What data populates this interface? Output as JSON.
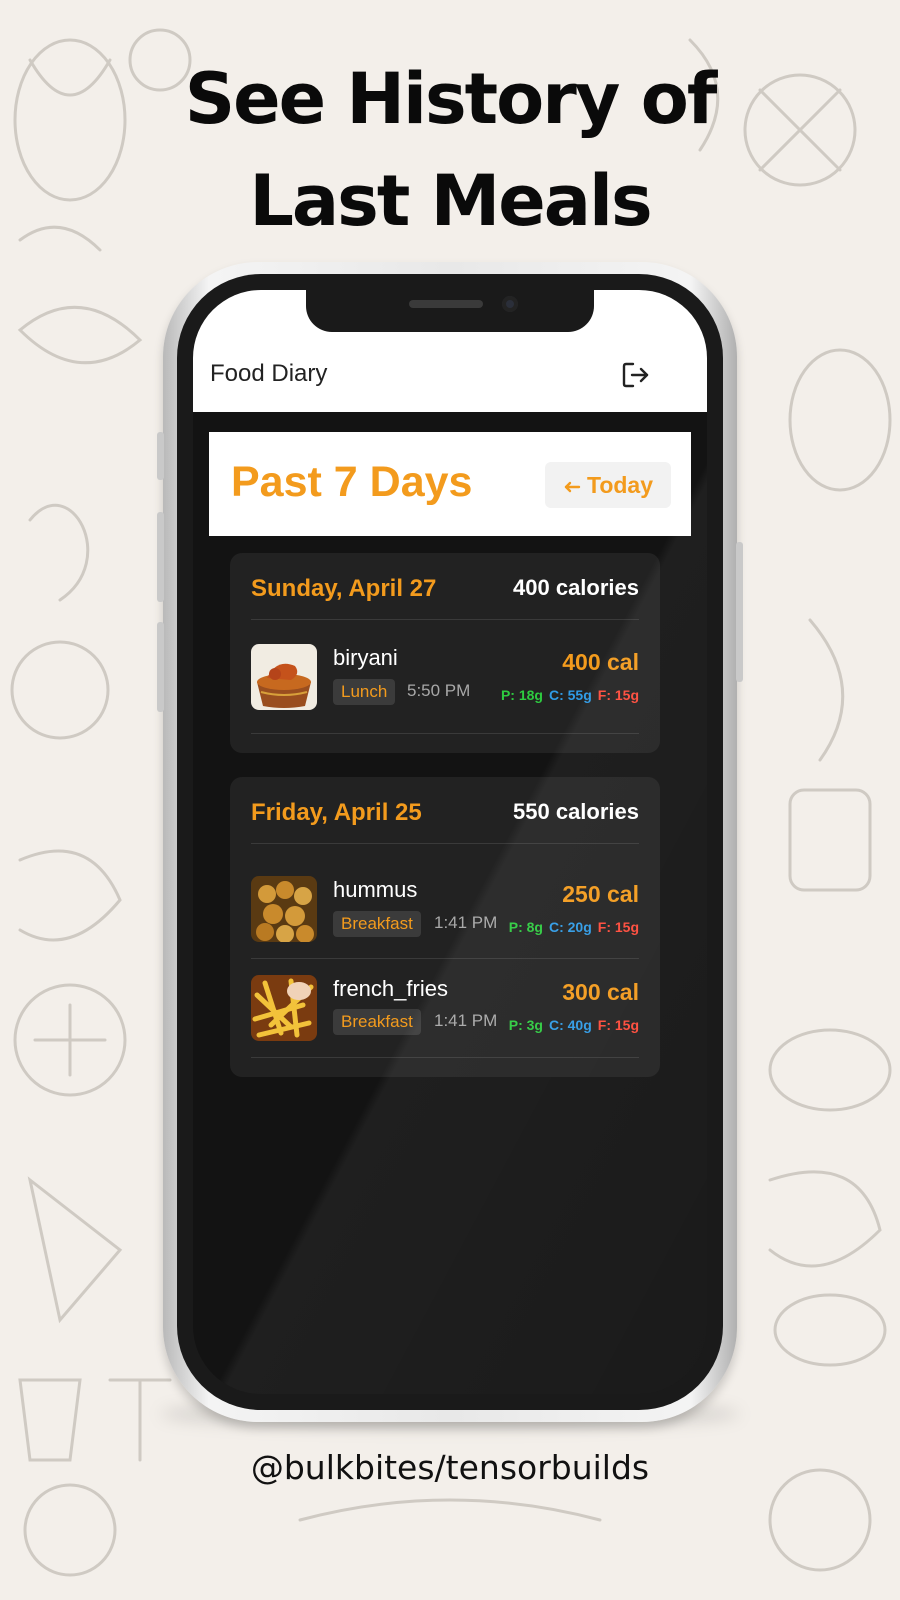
{
  "poster": {
    "headline_line1": "See History of",
    "headline_line2": "Last Meals",
    "credit": "@bulkbites/tensorbuilds"
  },
  "app": {
    "title": "Food Diary",
    "logout_icon": "logout-icon",
    "range_title": "Past 7 Days",
    "today_button": "Today",
    "today_icon": "arrow-left-icon"
  },
  "days": [
    {
      "date": "Sunday, April 27",
      "total": "400 calories",
      "meals": [
        {
          "name": "biryani",
          "tag": "Lunch",
          "time": "5:50 PM",
          "calories": "400 cal",
          "protein": "P: 18g",
          "carbs": "C: 55g",
          "fat": "F: 15g"
        }
      ]
    },
    {
      "date": "Friday, April 25",
      "total": "550 calories",
      "meals": [
        {
          "name": "hummus",
          "tag": "Breakfast",
          "time": "1:41 PM",
          "calories": "250 cal",
          "protein": "P: 8g",
          "carbs": "C: 20g",
          "fat": "F: 15g"
        },
        {
          "name": "french_fries",
          "tag": "Breakfast",
          "time": "1:41 PM",
          "calories": "300 cal",
          "protein": "P: 3g",
          "carbs": "C: 40g",
          "fat": "F: 15g"
        }
      ]
    }
  ],
  "colors": {
    "accent": "#f39b1d",
    "protein": "#2ecc40",
    "carbs": "#2f9be6",
    "fat": "#ff4a3a",
    "screen_bg": "#131313",
    "card_bg": "#222222"
  }
}
